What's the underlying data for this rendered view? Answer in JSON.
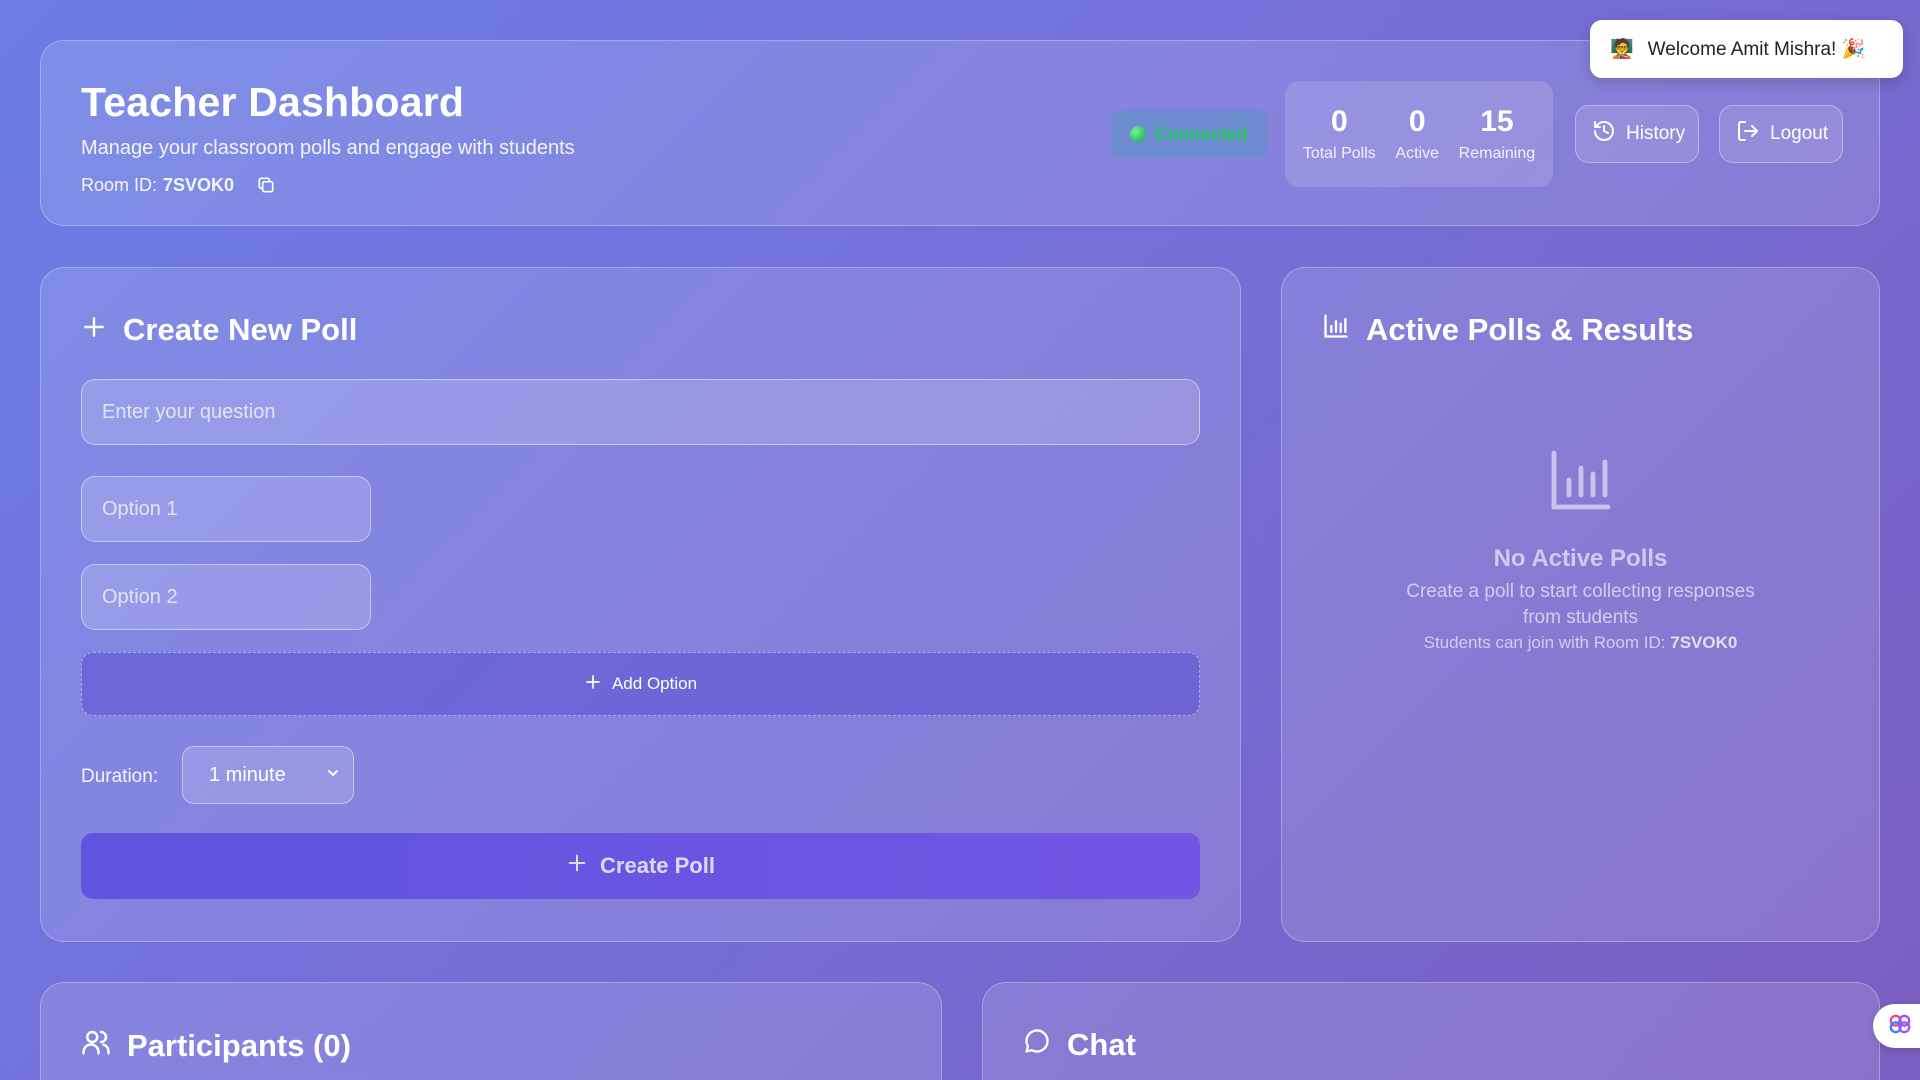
{
  "header": {
    "title": "Teacher Dashboard",
    "subtitle": "Manage your classroom polls and engage with students",
    "room_label": "Room ID:",
    "room_id": "7SVOK0",
    "status": "Connected",
    "stats": [
      {
        "value": "0",
        "label": "Total Polls"
      },
      {
        "value": "0",
        "label": "Active"
      },
      {
        "value": "15",
        "label": "Remaining"
      }
    ],
    "history_label": "History",
    "logout_label": "Logout"
  },
  "toast": {
    "message": "Welcome Amit Mishra! 🎉",
    "icon": "teacher-emoji-icon"
  },
  "create_poll": {
    "title": "Create New Poll",
    "question_placeholder": "Enter your question",
    "question_value": "",
    "options": [
      {
        "placeholder": "Option 1",
        "value": ""
      },
      {
        "placeholder": "Option 2",
        "value": ""
      }
    ],
    "add_option_label": "Add Option",
    "duration_label": "Duration:",
    "duration_value": "1 minute",
    "submit_label": "Create Poll"
  },
  "active_polls": {
    "title": "Active Polls & Results",
    "empty_title": "No Active Polls",
    "empty_text": "Create a poll to start collecting responses from students",
    "empty_room_prefix": "Students can join with Room ID:",
    "empty_room_id": "7SVOK0"
  },
  "participants": {
    "title": "Participants (0)"
  },
  "chat": {
    "title": "Chat"
  },
  "colors": {
    "connected": "#22c55e",
    "primary_button": "#6455e0"
  }
}
